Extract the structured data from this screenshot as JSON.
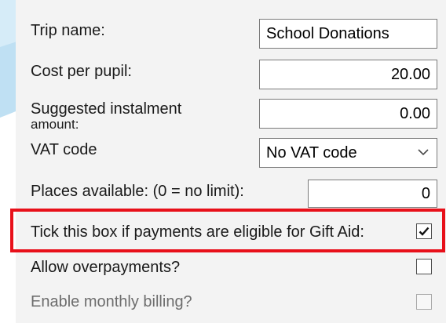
{
  "form": {
    "trip_name": {
      "label": "Trip name:",
      "value": "School Donations"
    },
    "cost_per_pupil": {
      "label": "Cost per pupil:",
      "value": "20.00"
    },
    "suggested_instalment": {
      "label_line1": "Suggested instalment",
      "label_line2": "amount:",
      "value": "0.00"
    },
    "vat_code": {
      "label": "VAT code",
      "selected": "No VAT code"
    },
    "places_available": {
      "label": "Places available: (0 = no limit):",
      "value": "0"
    },
    "gift_aid": {
      "label": "Tick this box if payments are eligible for Gift Aid:",
      "checked": true
    },
    "allow_overpayments": {
      "label": "Allow overpayments?",
      "checked": false
    },
    "monthly_billing": {
      "label": "Enable monthly billing?",
      "checked": false,
      "disabled": true
    }
  },
  "colors": {
    "panel_bg": "#f3f3f3",
    "backdrop_swoosh": "#bfe0f3",
    "highlight_border": "#e8101a"
  },
  "icons": {
    "vat_dropdown": "chevron-down-icon",
    "gift_aid_check": "checkmark-icon"
  }
}
